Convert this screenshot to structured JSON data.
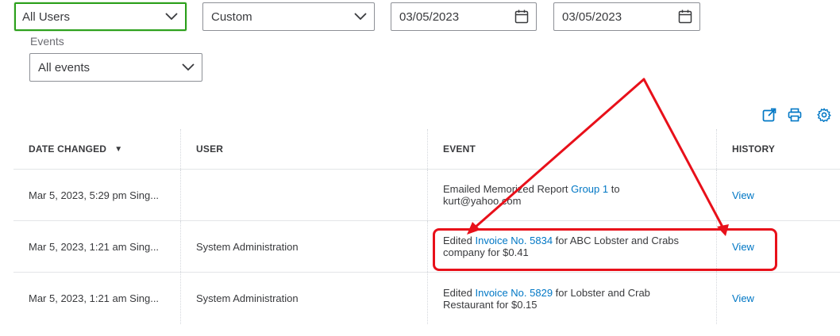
{
  "filters": {
    "users": {
      "value": "All Users"
    },
    "range": {
      "value": "Custom"
    },
    "date_from": {
      "value": "03/05/2023"
    },
    "date_to": {
      "value": "03/05/2023"
    },
    "events": {
      "label": "Events",
      "value": "All events"
    }
  },
  "toolbar": {
    "icons": [
      "export-icon",
      "print-icon",
      "gear-icon"
    ]
  },
  "table": {
    "headers": {
      "date": "DATE CHANGED",
      "sort_indicator": "▼",
      "user": "USER",
      "event": "EVENT",
      "history": "HISTORY"
    },
    "rows": [
      {
        "date": "Mar 5, 2023, 5:29 pm Sing...",
        "user": "",
        "event_pre": "Emailed Memorized Report ",
        "event_link": "Group 1",
        "event_post": " to kurt@yahoo.com",
        "history": "View"
      },
      {
        "date": "Mar 5, 2023, 1:21 am Sing...",
        "user": "System Administration",
        "event_pre": "Edited ",
        "event_link": "Invoice No. 5834",
        "event_post": " for ABC Lobster and Crabs company for $0.41",
        "history": "View"
      },
      {
        "date": "Mar 5, 2023, 1:21 am Sing...",
        "user": "System Administration",
        "event_pre": "Edited ",
        "event_link": "Invoice No. 5829",
        "event_post": " for Lobster and Crab Restaurant for $0.15",
        "history": "View"
      }
    ]
  },
  "colors": {
    "link": "#0077c5",
    "focus_border": "#2ca01c",
    "annotation": "#e8101a"
  }
}
